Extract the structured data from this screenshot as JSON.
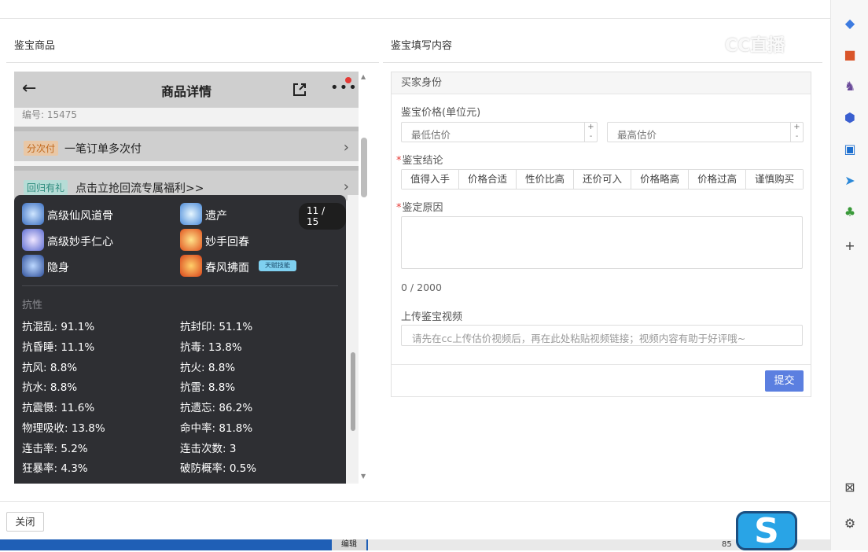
{
  "left_panel": {
    "title": "鉴宝商品"
  },
  "right_panel": {
    "title": "鉴宝填写内容"
  },
  "watermark": "CC直播",
  "phone": {
    "title": "商品详情",
    "serial": "编号: 15475",
    "rows": [
      {
        "tag": "分次付",
        "text": "一笔订单多次付"
      },
      {
        "tag": "回归有礼",
        "text": "点击立抢回流专属福利>>"
      }
    ],
    "counter": "11 / 15",
    "skills": [
      {
        "name": "高级仙风道骨"
      },
      {
        "name": "遗产"
      },
      {
        "name": "高级妙手仁心"
      },
      {
        "name": "妙手回春"
      },
      {
        "name": "隐身"
      },
      {
        "name": "春风拂面"
      }
    ],
    "special_badge": "天赋技能",
    "resist_label": "抗性",
    "stats": [
      "抗混乱: 91.1%",
      "抗封印: 51.1%",
      "抗昏睡: 11.1%",
      "抗毒: 13.8%",
      "抗风: 8.8%",
      "抗火: 8.8%",
      "抗水: 8.8%",
      "抗雷: 8.8%",
      "抗震慑: 11.6%",
      "抗遗忘: 86.2%",
      "物理吸收: 13.8%",
      "命中率: 81.8%",
      "连击率: 5.2%",
      "连击次数: 3",
      "狂暴率: 4.3%",
      "破防概率: 0.5%"
    ]
  },
  "form": {
    "header": "买家身份",
    "price_label": "鉴宝价格(单位元)",
    "min_placeholder": "最低估价",
    "max_placeholder": "最高估价",
    "conclusion_label": "鉴宝结论",
    "conclusion_options": [
      "值得入手",
      "价格合适",
      "性价比高",
      "还价可入",
      "价格略高",
      "价格过高",
      "谨慎购买"
    ],
    "reason_label": "鉴定原因",
    "char_counter": "0 / 2000",
    "video_label": "上传鉴宝视频",
    "video_placeholder": "请先在cc上传估价视频后，再在此处粘贴视频链接；视频内容有助于好评哦~",
    "submit_label": "提交"
  },
  "footer": {
    "close_label": "关闭"
  },
  "taskbar": {
    "edit_label": "编辑",
    "zoom": "85"
  },
  "sidebar_icons": [
    "tag-icon",
    "briefcase-icon",
    "chess-icon",
    "office-icon",
    "outlook-icon",
    "send-icon",
    "tree-icon",
    "plus-icon",
    "screenshot-icon",
    "settings-icon"
  ]
}
